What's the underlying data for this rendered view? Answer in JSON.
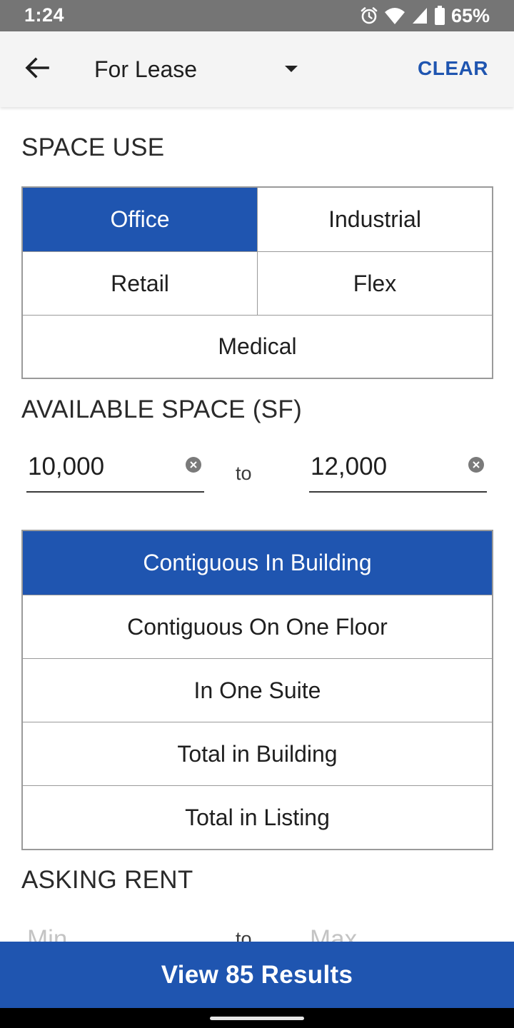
{
  "status_bar": {
    "time": "1:24",
    "battery": "65%",
    "icons": [
      "alarm-icon",
      "wifi-icon",
      "signal-icon",
      "battery-icon"
    ]
  },
  "app_bar": {
    "back_icon": "arrow-left-icon",
    "listing_type": "For Lease",
    "dropdown_icon": "caret-down-icon",
    "clear_label": "CLEAR"
  },
  "space_use": {
    "title": "SPACE USE",
    "options": [
      {
        "label": "Office",
        "selected": true
      },
      {
        "label": "Industrial",
        "selected": false
      },
      {
        "label": "Retail",
        "selected": false
      },
      {
        "label": "Flex",
        "selected": false
      },
      {
        "label": "Medical",
        "selected": false
      }
    ]
  },
  "available_space": {
    "title": "AVAILABLE SPACE (SF)",
    "min_value": "10,000",
    "max_value": "12,000",
    "separator": "to",
    "clear_icon": "clear-circle-icon",
    "options": [
      {
        "label": "Contiguous In Building",
        "selected": true
      },
      {
        "label": "Contiguous On One Floor",
        "selected": false
      },
      {
        "label": "In One Suite",
        "selected": false
      },
      {
        "label": "Total in Building",
        "selected": false
      },
      {
        "label": "Total in Listing",
        "selected": false
      }
    ]
  },
  "asking_rent": {
    "title": "ASKING RENT",
    "min_placeholder": "Min",
    "max_placeholder": "Max",
    "separator": "to"
  },
  "footer": {
    "results_label": "View 85 Results"
  },
  "colors": {
    "accent": "#1f55b0",
    "status_bar": "#757575",
    "app_bar": "#f4f4f4",
    "border": "#9a9a9a"
  }
}
